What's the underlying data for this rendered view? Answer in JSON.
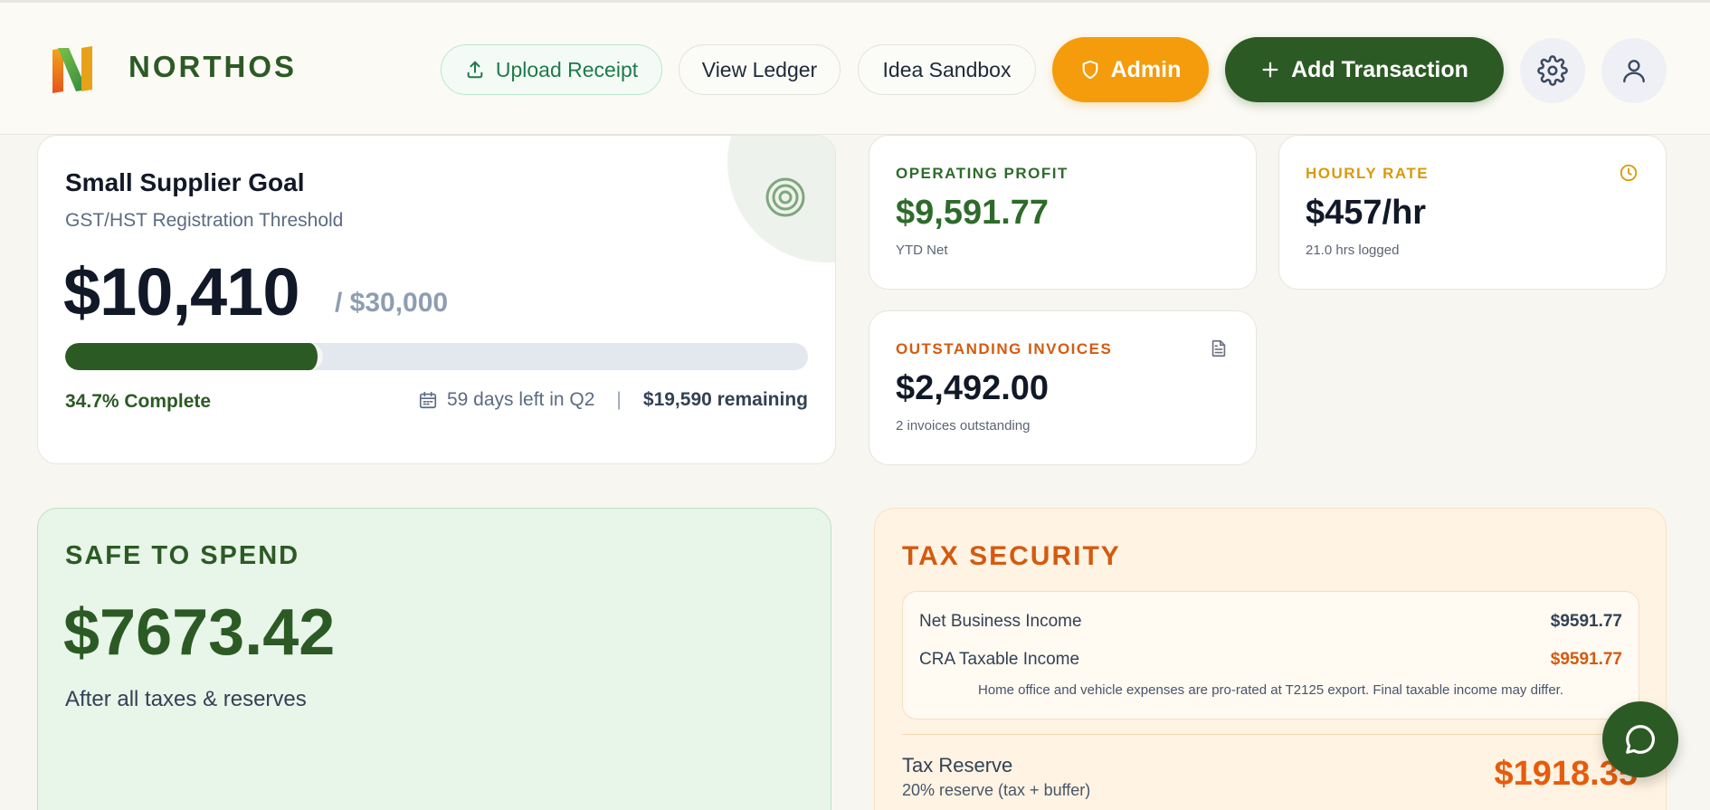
{
  "brand": {
    "name": "NORTHOS"
  },
  "header": {
    "upload_label": "Upload Receipt",
    "ledger_label": "View Ledger",
    "sandbox_label": "Idea Sandbox",
    "admin_label": "Admin",
    "add_label": "Add Transaction"
  },
  "icons": {
    "upload": "upload-icon",
    "shield": "shield-icon",
    "plus": "plus-icon",
    "settings": "gear-icon",
    "profile": "user-icon",
    "target": "target-icon",
    "calendar": "calendar-icon",
    "clock": "clock-icon",
    "document": "document-icon",
    "chat": "chat-icon"
  },
  "goal": {
    "title": "Small Supplier Goal",
    "subtitle": "GST/HST Registration Threshold",
    "amount": "$10,410",
    "target": "/ $30,000",
    "progress_fraction": 0.347,
    "percent_label": "34.7% Complete",
    "days_left": "59 days left in Q2",
    "separator": "|",
    "remaining": "$19,590 remaining"
  },
  "stats": {
    "profit": {
      "label": "OPERATING PROFIT",
      "value": "$9,591.77",
      "note": "YTD Net",
      "color": "#2e6b2a"
    },
    "rate": {
      "label": "HOURLY RATE",
      "value": "$457/hr",
      "note": "21.0 hrs logged",
      "color": "#d99a0b"
    },
    "invoices": {
      "label": "OUTSTANDING INVOICES",
      "value": "$2,492.00",
      "note": "2 invoices outstanding",
      "color": "#d45a10"
    }
  },
  "spend": {
    "label": "SAFE TO SPEND",
    "amount": "$7673.42",
    "subtitle": "After all taxes & reserves"
  },
  "tax": {
    "label": "TAX SECURITY",
    "net_label": "Net Business Income",
    "net_value": "$9591.77",
    "cra_label": "CRA Taxable Income",
    "cra_value": "$9591.77",
    "disclaimer": "Home office and vehicle expenses are pro-rated at T2125 export. Final taxable income may differ.",
    "reserve_label": "Tax Reserve",
    "reserve_sub": "20% reserve (tax + buffer)",
    "reserve_amount": "$1918.35"
  },
  "colors": {
    "brand_green": "#2c5a24",
    "admin_orange": "#f49c0b",
    "tax_orange": "#d45a10"
  }
}
